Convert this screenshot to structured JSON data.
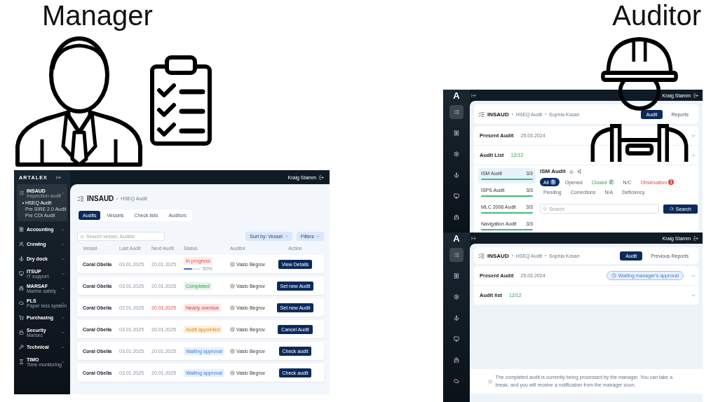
{
  "slide": {
    "left_title": "Manager",
    "right_title": "Auditor"
  },
  "manager_app": {
    "brand": "ARTALEX",
    "user": "Kraig Stamm",
    "sidebar": [
      {
        "label": "INSAUD",
        "sublabel": "Inspection audit",
        "expanded": true,
        "children": [
          {
            "label": "HSEQ Audit",
            "selected": true
          },
          {
            "label": "Pre SIRE 2.0 Audit",
            "selected": false
          },
          {
            "label": "Pre CDI Audit",
            "selected": false
          }
        ]
      },
      {
        "label": "Accounting",
        "expanded": false
      },
      {
        "label": "Crewing",
        "expanded": false
      },
      {
        "label": "Dry dock",
        "expanded": false
      },
      {
        "label": "ITSUP",
        "sublabel": "IT support",
        "expanded": false
      },
      {
        "label": "MARSAF",
        "sublabel": "Marine safety",
        "expanded": false
      },
      {
        "label": "PLS",
        "sublabel": "Paper less system",
        "expanded": false
      },
      {
        "label": "Purchasing",
        "expanded": false
      },
      {
        "label": "Security",
        "sublabel": "Marsec",
        "expanded": false
      },
      {
        "label": "Technical",
        "expanded": false
      },
      {
        "label": "TIMO",
        "sublabel": "Time monitoring",
        "expanded": false
      }
    ],
    "breadcrumb": [
      "INSAUD",
      "HSEQ Audit"
    ],
    "tabs": [
      {
        "label": "Audits",
        "selected": true
      },
      {
        "label": "Vessels",
        "selected": false
      },
      {
        "label": "Check lists",
        "selected": false
      },
      {
        "label": "Auditors",
        "selected": false
      }
    ],
    "search": {
      "placeholder": "Search vessel, Auditor"
    },
    "sort_button": "Sort by: Vessel",
    "filter_button": "Filters",
    "columns": [
      "Vessel",
      "Last Audit",
      "Next Audit",
      "Status",
      "Auditor",
      "Action"
    ],
    "rows": [
      {
        "vessel": "Coral Obelia",
        "last_audit": "03.01.2025",
        "next_audit": "20.01.2025",
        "overdue": false,
        "status": {
          "kind": "progress",
          "label": "In progress",
          "level": 0.5,
          "reading": "50%"
        },
        "auditor": "Vaslo Begrov",
        "action": "View Details"
      },
      {
        "vessel": "Coral Obelia",
        "last_audit": "03.01.2025",
        "next_audit": "20.01.2025",
        "overdue": false,
        "status": {
          "kind": "completed",
          "label": "Completed"
        },
        "auditor": "Vaslo Begrov",
        "action": "Set new Audit"
      },
      {
        "vessel": "Coral Obelia",
        "last_audit": "03.01.2025",
        "next_audit": "20.01.2025",
        "overdue": true,
        "status": {
          "kind": "overdue",
          "label": "Nearly overdue"
        },
        "auditor": "Vaslo Begrov",
        "action": "Set new Audit"
      },
      {
        "vessel": "Coral Obelia",
        "last_audit": "03.01.2025",
        "next_audit": "20.01.2025",
        "overdue": false,
        "status": {
          "kind": "appointed",
          "label": "Audit appointed"
        },
        "auditor": "Vaslo Begrov",
        "action": "Cancel Audit"
      },
      {
        "vessel": "Coral Obelia",
        "last_audit": "03.01.2025",
        "next_audit": "20.01.2025",
        "overdue": false,
        "status": {
          "kind": "waiting",
          "label": "Waiting approval"
        },
        "auditor": "Vaslo Begrov",
        "action": "Check audit"
      },
      {
        "vessel": "Coral Obelia",
        "last_audit": "03.01.2025",
        "next_audit": "20.01.2025",
        "overdue": false,
        "status": {
          "kind": "waiting",
          "label": "Waiting approval"
        },
        "auditor": "Vaslo Begrov",
        "action": "Check audit"
      }
    ]
  },
  "auditor_app_top": {
    "logo": "A",
    "user": "Kraig Stamm",
    "nav": [
      {
        "selected": true
      },
      {
        "selected": false
      },
      {
        "selected": false
      },
      {
        "selected": false
      },
      {
        "selected": false
      },
      {
        "selected": false
      }
    ],
    "breadcrumb": [
      "INSAUD",
      "HSEQ Audit",
      "Sophia Kosan"
    ],
    "tabs": [
      {
        "label": "Audit",
        "selected": true
      },
      {
        "label": "Reports",
        "selected": false
      }
    ],
    "sections": [
      {
        "title": "Present Audit",
        "value": "25.03.2024",
        "kind": "date",
        "expanded": false
      },
      {
        "title": "Audit List",
        "value": "12/12",
        "kind": "count",
        "expanded": true
      }
    ],
    "audit_list": [
      {
        "name": "ISM Audit",
        "count": "3/3",
        "level": 1,
        "selected": true
      },
      {
        "name": "ISPS Audit",
        "count": "3/3",
        "level": 1,
        "selected": false
      },
      {
        "name": "MLC 2006 Audit",
        "count": "3/3",
        "level": 1,
        "selected": false
      },
      {
        "name": "Navigation Audit",
        "count": "3/3",
        "level": 1,
        "selected": false
      }
    ],
    "detail": {
      "title": "ISM Audit",
      "filters": [
        {
          "label": "All",
          "count": "5",
          "kind": "all",
          "selected": true
        },
        {
          "label": "Opened",
          "kind": "plain",
          "selected": false
        },
        {
          "label": "Closed",
          "count": "2",
          "kind": "closed",
          "selected": false
        },
        {
          "label": "N/C",
          "kind": "plain",
          "selected": false
        },
        {
          "label": "Observation",
          "count": "1",
          "kind": "observation",
          "selected": false
        },
        {
          "label": "Pending",
          "kind": "plain",
          "selected": false
        },
        {
          "label": "Corrections",
          "kind": "plain",
          "selected": false
        },
        {
          "label": "N/A",
          "kind": "plain",
          "selected": false
        },
        {
          "label": "Deficiency",
          "kind": "plain",
          "selected": false
        }
      ],
      "search": {
        "placeholder": "Search"
      },
      "search_button": "Search"
    }
  },
  "auditor_app_bottom": {
    "logo": "A",
    "user": "Kraig Stamm",
    "nav": [
      {
        "selected": true
      },
      {
        "selected": false
      },
      {
        "selected": false
      },
      {
        "selected": false
      },
      {
        "selected": false
      },
      {
        "selected": false
      },
      {
        "selected": false
      }
    ],
    "breadcrumb": [
      "INSAUD",
      "HSEQ Audit",
      "Sophia Kosan"
    ],
    "tabs": [
      {
        "label": "Audit",
        "selected": true
      },
      {
        "label": "Previous Reports",
        "selected": false
      }
    ],
    "sections": [
      {
        "title": "Present Audit",
        "value": "25.03.2024",
        "kind": "date",
        "status": "Waiting manager's approval",
        "expanded": false
      },
      {
        "title": "Audit list",
        "value": "12/12",
        "kind": "count",
        "expanded": false
      }
    ],
    "notice": "The completed audit is currently being processed by the manager. You can take a break, and you will receive a notification from the manager soon."
  }
}
